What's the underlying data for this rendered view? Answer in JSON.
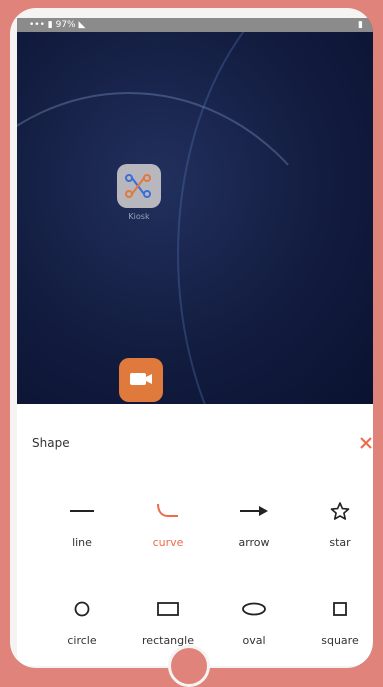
{
  "status_bar": {
    "left_text": "••• ▮ 97% ◣",
    "right_text": "▮"
  },
  "home": {
    "app_label": "Kiosk",
    "app1_icon": "network-graph-icon",
    "app2_icon": "video-camera-icon"
  },
  "sheet": {
    "title": "Shape",
    "close_icon": "close-icon",
    "shapes": [
      {
        "label": "line",
        "icon": "line-icon"
      },
      {
        "label": "curve",
        "icon": "curve-icon",
        "active": true
      },
      {
        "label": "arrow",
        "icon": "arrow-icon"
      },
      {
        "label": "star",
        "icon": "star-icon"
      },
      {
        "label": "circle",
        "icon": "circle-icon"
      },
      {
        "label": "rectangle",
        "icon": "rectangle-icon"
      },
      {
        "label": "oval",
        "icon": "oval-icon"
      },
      {
        "label": "square",
        "icon": "square-icon"
      }
    ]
  },
  "colors": {
    "accent": "#f06a4a",
    "frame": "#e0837a",
    "text": "#333333"
  }
}
